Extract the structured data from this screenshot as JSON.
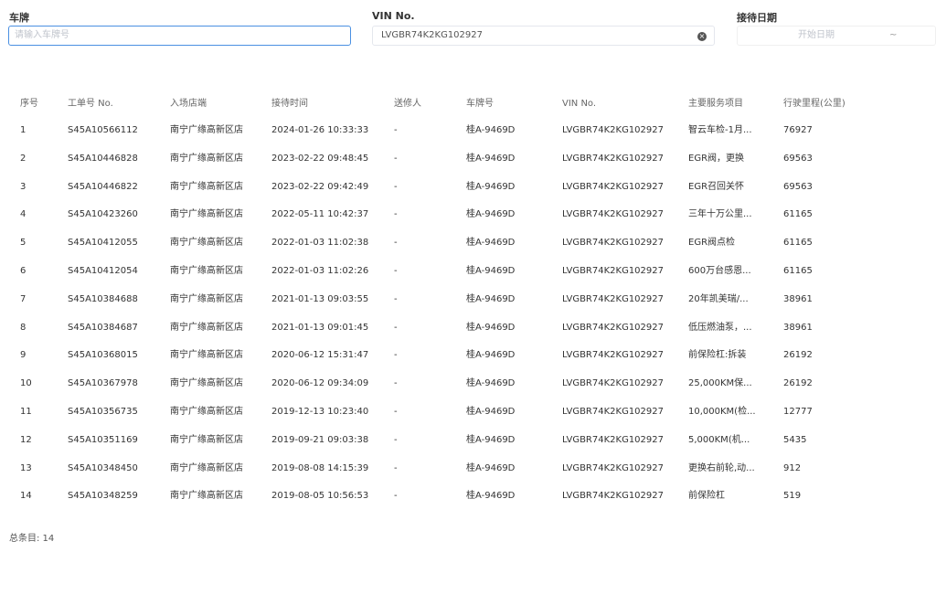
{
  "filters": {
    "plate_label": "车牌",
    "plate_placeholder": "请输入车牌号",
    "vin_label": "VIN No.",
    "vin_value": "LVGBR74K2KG102927",
    "date_label": "接待日期",
    "date_start_placeholder": "开始日期",
    "date_separator": "~"
  },
  "table": {
    "headers": [
      "序号",
      "工单号 No.",
      "入场店端",
      "接待时间",
      "送修人",
      "车牌号",
      "VIN No.",
      "主要服务项目",
      "行驶里程(公里)"
    ],
    "rows": [
      [
        "1",
        "S45A10566112",
        "南宁广缘高新区店",
        "2024-01-26 10:33:33",
        "-",
        "桂A-9469D",
        "LVGBR74K2KG102927",
        "智云车检-1月...",
        "76927"
      ],
      [
        "2",
        "S45A10446828",
        "南宁广缘高新区店",
        "2023-02-22 09:48:45",
        "-",
        "桂A-9469D",
        "LVGBR74K2KG102927",
        "EGR阀，更换",
        "69563"
      ],
      [
        "3",
        "S45A10446822",
        "南宁广缘高新区店",
        "2023-02-22 09:42:49",
        "-",
        "桂A-9469D",
        "LVGBR74K2KG102927",
        "EGR召回关怀",
        "69563"
      ],
      [
        "4",
        "S45A10423260",
        "南宁广缘高新区店",
        "2022-05-11 10:42:37",
        "-",
        "桂A-9469D",
        "LVGBR74K2KG102927",
        "三年十万公里...",
        "61165"
      ],
      [
        "5",
        "S45A10412055",
        "南宁广缘高新区店",
        "2022-01-03 11:02:38",
        "-",
        "桂A-9469D",
        "LVGBR74K2KG102927",
        "EGR阀点检",
        "61165"
      ],
      [
        "6",
        "S45A10412054",
        "南宁广缘高新区店",
        "2022-01-03 11:02:26",
        "-",
        "桂A-9469D",
        "LVGBR74K2KG102927",
        "600万台感恩...",
        "61165"
      ],
      [
        "7",
        "S45A10384688",
        "南宁广缘高新区店",
        "2021-01-13 09:03:55",
        "-",
        "桂A-9469D",
        "LVGBR74K2KG102927",
        "20年凯美瑞/...",
        "38961"
      ],
      [
        "8",
        "S45A10384687",
        "南宁广缘高新区店",
        "2021-01-13 09:01:45",
        "-",
        "桂A-9469D",
        "LVGBR74K2KG102927",
        "低压燃油泵，...",
        "38961"
      ],
      [
        "9",
        "S45A10368015",
        "南宁广缘高新区店",
        "2020-06-12 15:31:47",
        "-",
        "桂A-9469D",
        "LVGBR74K2KG102927",
        "前保险杠:拆装",
        "26192"
      ],
      [
        "10",
        "S45A10367978",
        "南宁广缘高新区店",
        "2020-06-12 09:34:09",
        "-",
        "桂A-9469D",
        "LVGBR74K2KG102927",
        "25,000KM保...",
        "26192"
      ],
      [
        "11",
        "S45A10356735",
        "南宁广缘高新区店",
        "2019-12-13 10:23:40",
        "-",
        "桂A-9469D",
        "LVGBR74K2KG102927",
        "10,000KM(检...",
        "12777"
      ],
      [
        "12",
        "S45A10351169",
        "南宁广缘高新区店",
        "2019-09-21 09:03:38",
        "-",
        "桂A-9469D",
        "LVGBR74K2KG102927",
        "5,000KM(机...",
        "5435"
      ],
      [
        "13",
        "S45A10348450",
        "南宁广缘高新区店",
        "2019-08-08 14:15:39",
        "-",
        "桂A-9469D",
        "LVGBR74K2KG102927",
        "更换右前轮,动...",
        "912"
      ],
      [
        "14",
        "S45A10348259",
        "南宁广缘高新区店",
        "2019-08-05 10:56:53",
        "-",
        "桂A-9469D",
        "LVGBR74K2KG102927",
        "前保险杠",
        "519"
      ]
    ]
  },
  "footer": {
    "total_label": "总条目: 14"
  },
  "colors": {
    "focus_border": "#4a90e2",
    "border": "#e4e7ed"
  }
}
